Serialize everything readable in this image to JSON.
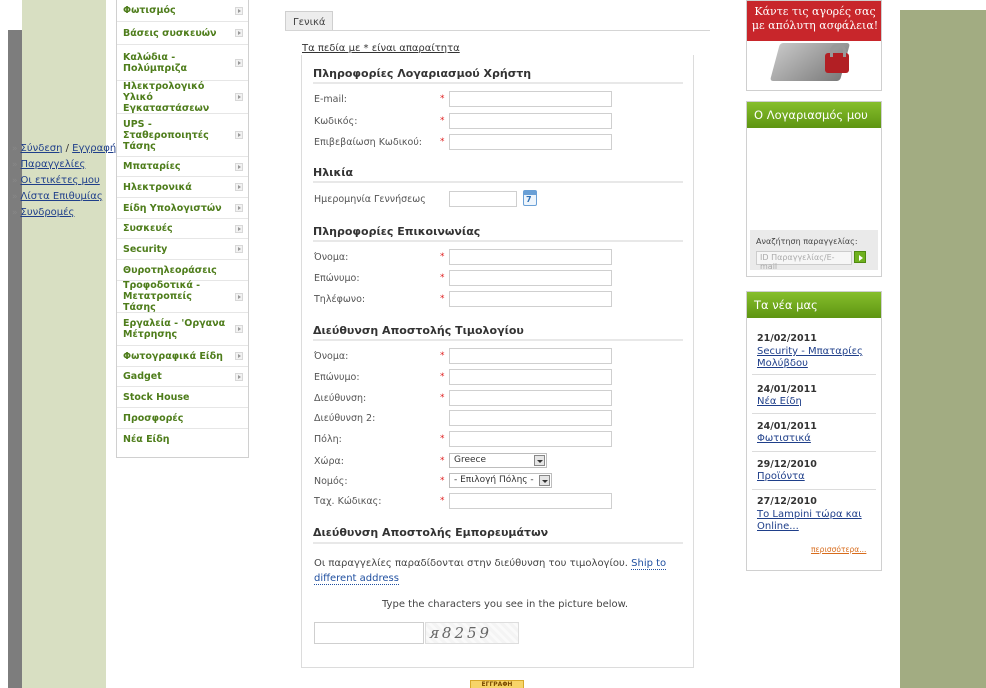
{
  "categories": [
    {
      "label": "Φωτισμός",
      "arrow": true
    },
    {
      "label": "Βάσεις συσκευών",
      "arrow": true
    },
    {
      "label": "Καλώδια - Πολύμπριζα",
      "arrow": true
    },
    {
      "label": "Ηλεκτρολογικό Υλικό Εγκαταστάσεων",
      "arrow": true
    },
    {
      "label": "UPS - Σταθεροποιητές Τάσης",
      "arrow": true
    },
    {
      "label": "Μπαταρίες",
      "arrow": true
    },
    {
      "label": "Ηλεκτρονικά",
      "arrow": true
    },
    {
      "label": "Είδη Υπολογιστών",
      "arrow": true
    },
    {
      "label": "Συσκευές",
      "arrow": true
    },
    {
      "label": "Security",
      "arrow": true
    },
    {
      "label": "Θυροτηλεοράσεις",
      "arrow": false
    },
    {
      "label": "Τροφοδοτικά - Μετατροπείς Τάσης",
      "arrow": true
    },
    {
      "label": "Εργαλεία - 'Οργανα Μέτρησης",
      "arrow": true
    },
    {
      "label": "Φωτογραφικά Είδη",
      "arrow": true
    },
    {
      "label": "Gadget",
      "arrow": true
    },
    {
      "label": "Stock House",
      "arrow": false
    },
    {
      "label": "Προσφορές",
      "arrow": false
    },
    {
      "label": "Νέα Είδη",
      "arrow": false
    }
  ],
  "form": {
    "tab": "Γενικά",
    "required_note": "Τα πεδία με * είναι απαραίτητα",
    "required_mark": "*",
    "sections": {
      "account": "Πληροφορίες Λογαριασμού Χρήστη",
      "age": "Ηλικία",
      "contact": "Πληροφορίες Επικοινωνίας",
      "billing": "Διεύθυνση Αποστολής Τιμολογίου",
      "shipping": "Διεύθυνση Αποστολής Εμπορευμάτων"
    },
    "account_fields": {
      "email": "E-mail:",
      "password": "Κωδικός:",
      "confirm": "Επιβεβαίωση Κωδικού:"
    },
    "age_field": "Ημερομηνία Γεννήσεως",
    "calendar_day": "7",
    "contact_fields": {
      "first": "Όνομα:",
      "last": "Επώνυμο:",
      "phone": "Τηλέφωνο:"
    },
    "billing_fields": {
      "first": "Όνομα:",
      "last": "Επώνυμο:",
      "address": "Διεύθυνση:",
      "address2": "Διεύθυνση 2:",
      "city": "Πόλη:",
      "country": "Χώρα:",
      "prefecture": "Νομός:",
      "zip": "Ταχ. Κώδικας:"
    },
    "country_value": "Greece",
    "prefecture_value": "- Επιλογή Πόλης -",
    "shipping_text": "Οι παραγγελίες παραδίδονται στην διεύθυνση του τιμολογίου.",
    "shipping_link": "Ship to different address",
    "captcha_instruction": "Type the characters you see in the picture below.",
    "captcha_code": "ᴙ8259",
    "submit": "ΕΓΓΡΑΦΗ"
  },
  "banner": {
    "line1": "Κάντε τις αγορές σας",
    "line2": "με απόλυτη ασφάλεια!"
  },
  "account_panel": {
    "title": "Ο Λογαριασμός μου",
    "login": "Σύνδεση",
    "separator": "/",
    "register": "Εγγραφή",
    "links": [
      "Παραγγελίες",
      "Οι ετικέτες μου",
      "Λίστα Επιθυμίας",
      "Συνδρομές"
    ],
    "order_search_label": "Αναζήτηση παραγγελίας:",
    "order_search_placeholder": "ID Παραγγελίας/E-mail"
  },
  "news_panel": {
    "title": "Τα νέα μας",
    "items": [
      {
        "date": "21/02/2011",
        "title": "Security - Μπαταρίες Μολύβδου"
      },
      {
        "date": "24/01/2011",
        "title": "Νέα Είδη"
      },
      {
        "date": "24/01/2011",
        "title": "Φωτιστικά"
      },
      {
        "date": "29/12/2010",
        "title": "Προϊόντα"
      },
      {
        "date": "27/12/2010",
        "title": "Το Lampini τώρα και Online..."
      }
    ],
    "more": "περισσότερα..."
  }
}
